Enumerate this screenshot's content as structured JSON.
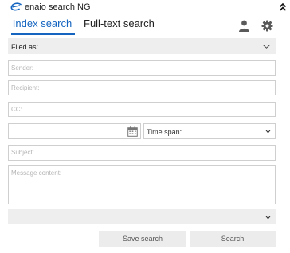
{
  "app": {
    "title": "enaio search NG",
    "brand_color": "#1565c0"
  },
  "tabs": [
    {
      "label": "Index search",
      "active": true
    },
    {
      "label": "Full-text search",
      "active": false
    }
  ],
  "toolbar": {
    "user_icon": "user-icon",
    "settings_icon": "gear-icon",
    "collapse_icon": "double-chevron-up-icon"
  },
  "form": {
    "filed_as": {
      "value": "Filed as:"
    },
    "sender": {
      "placeholder": "Sender:"
    },
    "recipient": {
      "placeholder": "Recipient:"
    },
    "cc": {
      "placeholder": "CC:"
    },
    "date": {
      "value": "",
      "icon": "calendar-icon"
    },
    "time_span": {
      "value": "Time span:"
    },
    "subject": {
      "placeholder": "Subject:"
    },
    "message": {
      "placeholder": "Message content:"
    },
    "extra_dropdown": {
      "value": ""
    }
  },
  "actions": {
    "save_label": "Save search",
    "search_label": "Search"
  }
}
